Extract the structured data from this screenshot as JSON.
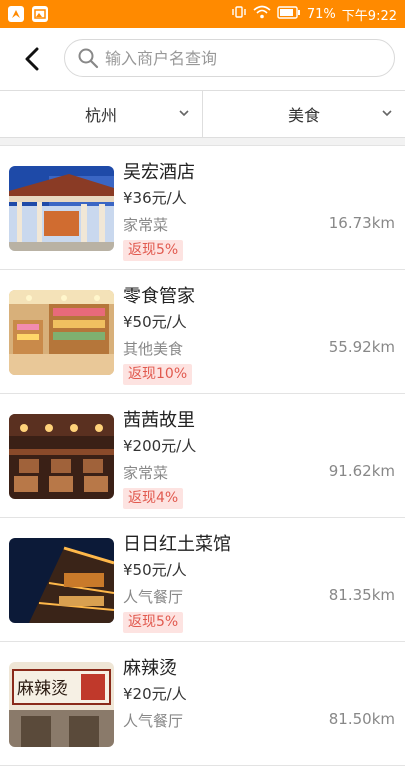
{
  "status_bar": {
    "battery": "71%",
    "time": "下午9:22"
  },
  "search": {
    "placeholder": "输入商户名查询",
    "value": ""
  },
  "filters": [
    {
      "label": "杭州"
    },
    {
      "label": "美食"
    }
  ],
  "merchants": [
    {
      "name": "吴宏酒店",
      "price": "¥36元/人",
      "category": "家常菜",
      "distance": "16.73km",
      "cashback": "返现5%"
    },
    {
      "name": "零食管家",
      "price": "¥50元/人",
      "category": "其他美食",
      "distance": "55.92km",
      "cashback": "返现10%"
    },
    {
      "name": "茜茜故里",
      "price": "¥200元/人",
      "category": "家常菜",
      "distance": "91.62km",
      "cashback": "返现4%"
    },
    {
      "name": "日日红土菜馆",
      "price": "¥50元/人",
      "category": "人气餐厅",
      "distance": "81.35km",
      "cashback": "返现5%"
    },
    {
      "name": "麻辣烫",
      "price": "¥20元/人",
      "category": "人气餐厅",
      "distance": "81.50km",
      "cashback": "",
      "sign_text": "麻辣烫"
    }
  ],
  "colors": {
    "status_bar": "#ff8a00",
    "badge_bg": "#fde3e1",
    "badge_text": "#e15a4f"
  }
}
